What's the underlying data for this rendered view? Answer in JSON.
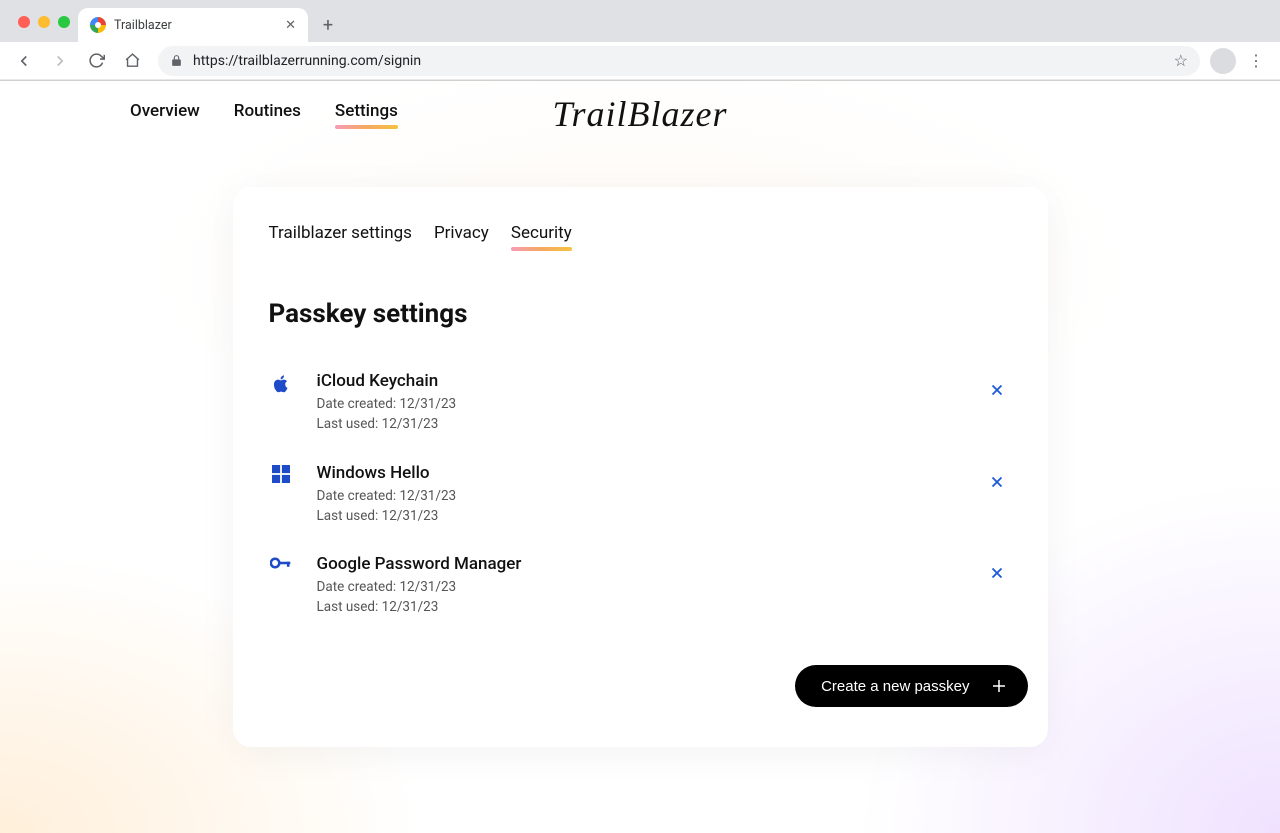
{
  "browser": {
    "tab_title": "Trailblazer",
    "url": "https://trailblazerrunning.com/signin"
  },
  "nav": {
    "items": [
      "Overview",
      "Routines",
      "Settings"
    ],
    "active": "Settings",
    "brand": "TrailBlazer"
  },
  "subnav": {
    "items": [
      "Trailblazer settings",
      "Privacy",
      "Security"
    ],
    "active": "Security"
  },
  "section": {
    "title": "Passkey settings"
  },
  "passkeys": [
    {
      "name": "iCloud Keychain",
      "created_label": "Date created: 12/31/23",
      "used_label": "Last used: 12/31/23",
      "icon": "apple"
    },
    {
      "name": "Windows Hello",
      "created_label": "Date created: 12/31/23",
      "used_label": "Last used: 12/31/23",
      "icon": "windows"
    },
    {
      "name": "Google Password Manager",
      "created_label": "Date created: 12/31/23",
      "used_label": "Last used: 12/31/23",
      "icon": "key"
    }
  ],
  "cta": {
    "label": "Create a new passkey"
  }
}
